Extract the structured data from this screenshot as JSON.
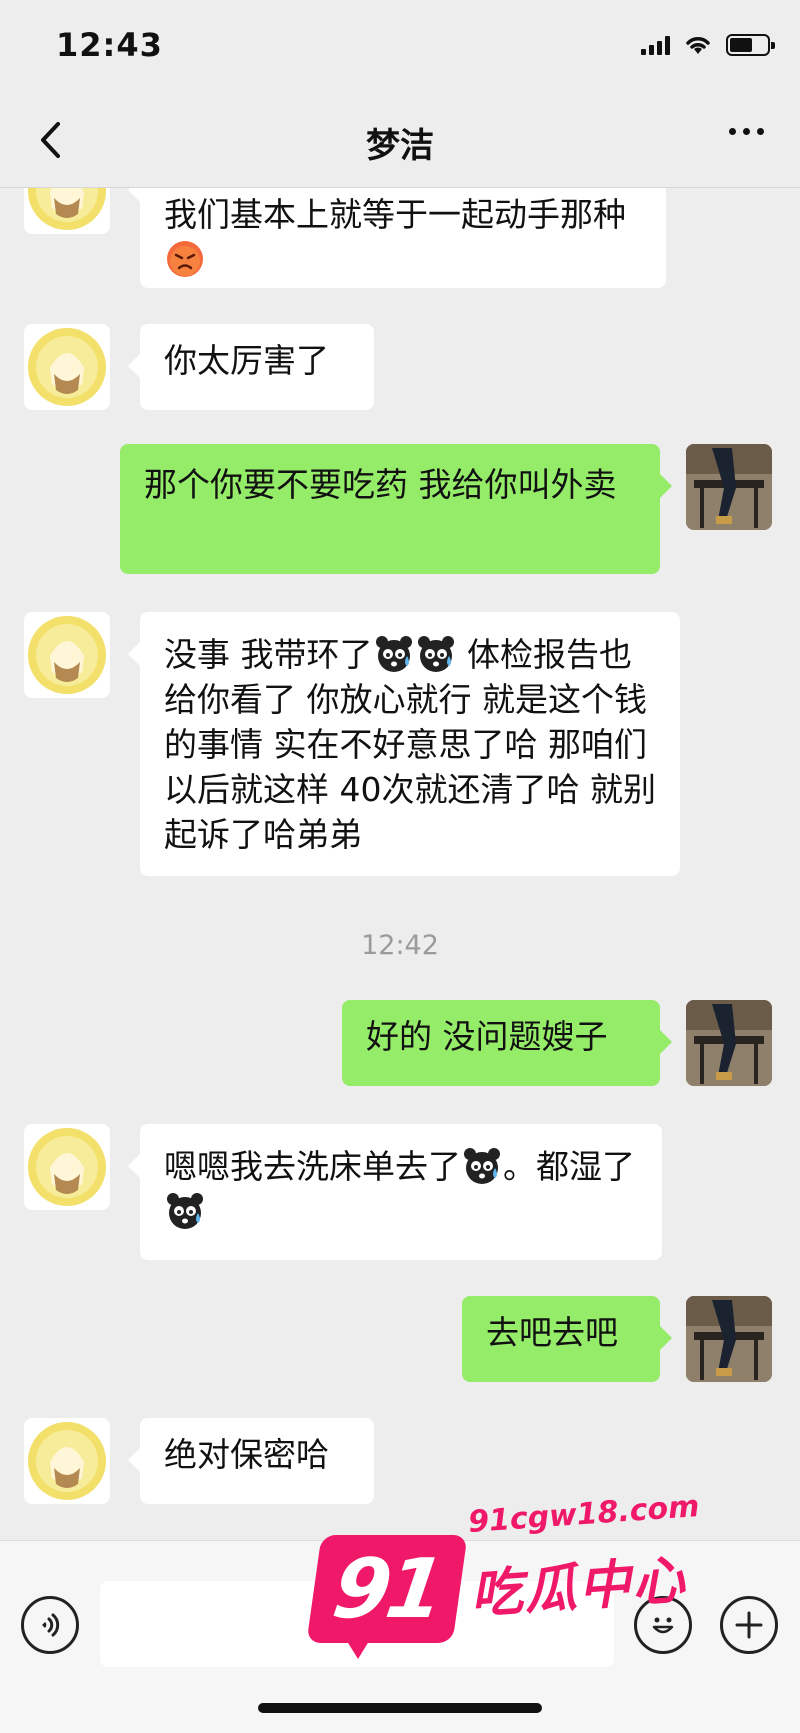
{
  "status_bar": {
    "time": "12:43"
  },
  "nav": {
    "title": "梦洁"
  },
  "messages": [
    {
      "side": "left",
      "text_parts": [
        "我们基本上就等于一起动手那种",
        ""
      ]
    },
    {
      "side": "left",
      "text": "你太厉害了"
    },
    {
      "side": "right",
      "text": "那个你要不要吃药 我给你叫外卖"
    },
    {
      "side": "left",
      "text_parts": [
        "没事 我带环了",
        " 体检报告也给你看了 你放心就行 就是这个钱的事情 实在不好意思了哈 那咱们以后就这样 40次就还清了哈 就别起诉了哈弟弟"
      ]
    },
    {
      "side": "right",
      "text": "好的 没问题嫂子"
    },
    {
      "side": "left",
      "text_parts": [
        "  嗯嗯我去洗床单去了",
        "。都湿了"
      ]
    },
    {
      "side": "right",
      "text": "去吧去吧"
    },
    {
      "side": "left",
      "text": "绝对保密哈"
    }
  ],
  "timestamp": "12:42",
  "emoji_icons": [
    "angry-face-emoji",
    "sweat-bear-emoji"
  ],
  "watermark": {
    "number": "91",
    "url": "91cgw18.com",
    "text": "吃瓜中心"
  },
  "colors": {
    "bubble_right": "#95ec69",
    "bubble_left": "#ffffff",
    "background": "#ededed",
    "watermark": "#f01868"
  }
}
